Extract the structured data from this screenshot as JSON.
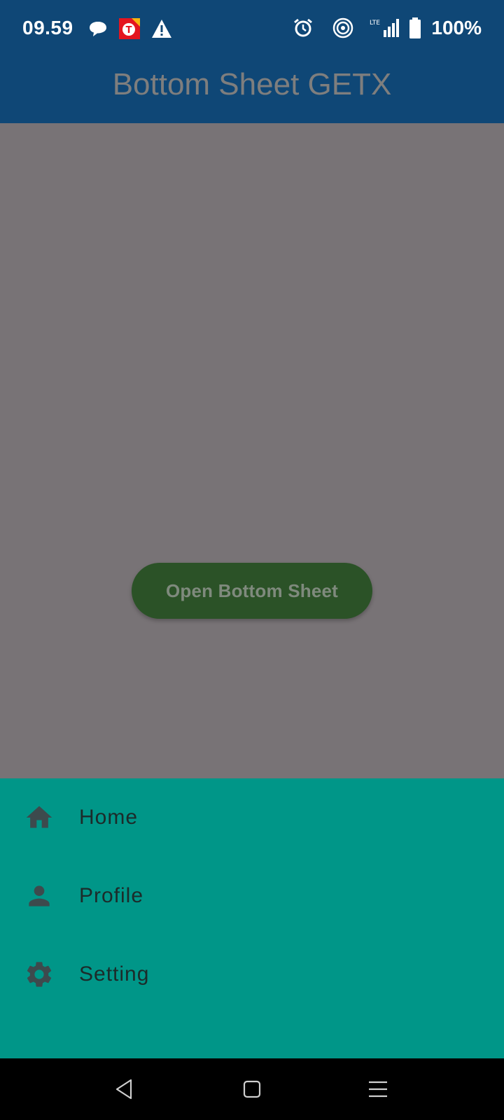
{
  "status_bar": {
    "time": "09.59",
    "battery": "100%",
    "icons": [
      "chat-bubble-icon",
      "telkomsel-app-icon",
      "warning-icon",
      "alarm-icon",
      "hotspot-icon",
      "lte-signal-icon",
      "battery-icon"
    ],
    "network_label": "LTE"
  },
  "app_bar": {
    "title": "Bottom Sheet GETX"
  },
  "main": {
    "open_button_label": "Open Bottom Sheet"
  },
  "bottom_sheet": {
    "items": [
      {
        "label": "Home",
        "icon": "home-icon"
      },
      {
        "label": "Profile",
        "icon": "person-icon"
      },
      {
        "label": "Setting",
        "icon": "gear-icon"
      }
    ]
  },
  "nav_bar": {
    "buttons": [
      "back-icon",
      "home-square-icon",
      "recents-menu-icon"
    ]
  },
  "colors": {
    "app_bar": "#0f4776",
    "scrim": "#787376",
    "button": "#2b5227",
    "sheet": "#009688"
  }
}
